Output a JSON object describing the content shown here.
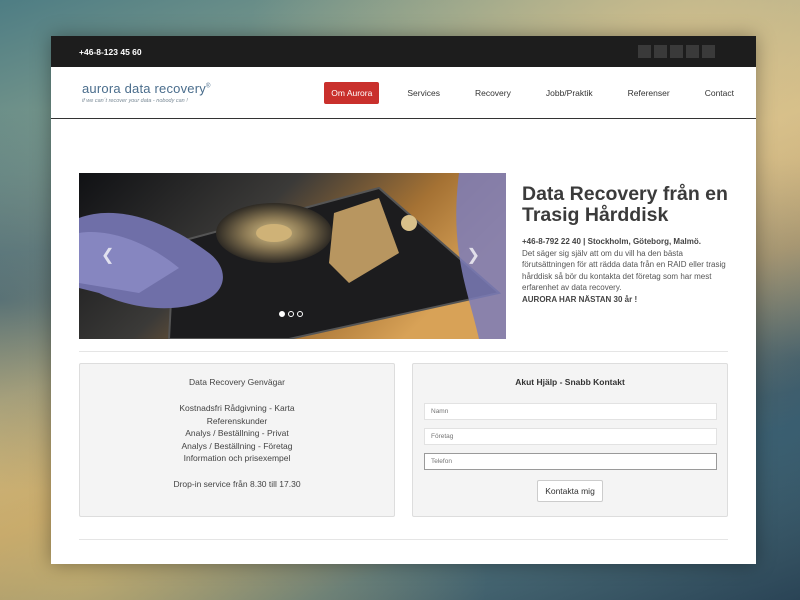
{
  "topbar": {
    "phone": "+46-8-123 45 60",
    "social_icons": [
      "social-icon-1",
      "social-icon-2",
      "social-icon-3",
      "social-icon-4",
      "social-icon-5"
    ]
  },
  "header": {
    "logo_title": "aurora data recovery",
    "logo_mark": "®",
    "logo_tagline": "if we can´t recover your data - nobody can !"
  },
  "nav": {
    "items": [
      {
        "label": "Om Aurora",
        "active": true
      },
      {
        "label": "Services"
      },
      {
        "label": "Recovery"
      },
      {
        "label": "Jobb/Praktik"
      },
      {
        "label": "Referenser"
      },
      {
        "label": "Contact"
      }
    ]
  },
  "slider": {
    "prev_icon": "chevron-left-icon",
    "next_icon": "chevron-right-icon",
    "prev_glyph": "❮",
    "next_glyph": "❯",
    "slide_count": 3,
    "active_slide": 1
  },
  "hero": {
    "title": "Data Recovery från en Trasig Hårddisk",
    "contact_line": "+46-8-792 22 40 | Stockholm, Göteborg, Malmö.",
    "body": "Det säger sig själv att om du vill ha den bästa förutsättningen för att rädda data från en RAID eller trasig hårddisk så bör du kontakta det företag som har mest erfarenhet av data recovery.",
    "highlight": "AURORA HAR NÄSTAN 30 år !"
  },
  "shortcuts": {
    "title": "Data Recovery Genvägar",
    "links": [
      "Kostnadsfri Rådgivning - Karta",
      "Referenskunder",
      "Analys / Beställning - Privat",
      "Analys / Beställning - Företag",
      "Information och prisexempel"
    ],
    "dropin": "Drop-in service från 8.30 till 17.30"
  },
  "quick_contact": {
    "title": "Akut Hjälp - Snabb Kontakt",
    "fields": {
      "name": "Namn",
      "company": "Företag",
      "phone": "Telefon"
    },
    "submit": "Kontakta mig"
  },
  "colors": {
    "accent": "#c9302c",
    "topbar": "#1d1d1d",
    "logo": "#4a6d8c"
  }
}
